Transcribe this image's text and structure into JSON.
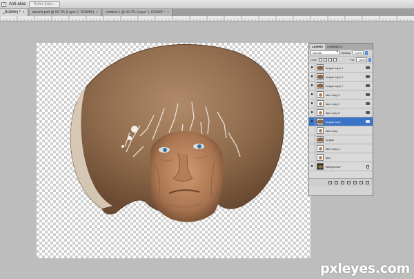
{
  "options_bar": {
    "antialias_label": "Anti-alias",
    "refine_edge_label": "Refine Edge..."
  },
  "tabs": [
    {
      "label": "_RGB/8#) *",
      "active": true
    },
    {
      "label": "ancient.psd @ 66.7% (Layer 2, RGB/8#)",
      "active": false
    },
    {
      "label": "Untitled-1 @ 66.7% (Layer 1, RGB/8) *",
      "active": false
    }
  ],
  "layers_panel": {
    "tab_layers": "LAYERS",
    "tab_channels": "CHANNELS",
    "blend_mode": "Normal",
    "opacity_label": "Opacity:",
    "opacity_value": "100%",
    "lock_label": "Lock:",
    "fill_label": "Fill:",
    "fill_value": "100%",
    "layers": [
      {
        "name": "fungus copy 4",
        "visible": true,
        "thumb": "fungus",
        "selected": false,
        "fx": true
      },
      {
        "name": "fungus copy 3",
        "visible": true,
        "thumb": "fungus",
        "selected": false,
        "fx": true
      },
      {
        "name": "fungus copy 2",
        "visible": true,
        "thumb": "fungus",
        "selected": false,
        "fx": true
      },
      {
        "name": "face copy 3",
        "visible": true,
        "thumb": "face",
        "selected": false,
        "fx": true
      },
      {
        "name": "face copy 4",
        "visible": true,
        "thumb": "face",
        "selected": false,
        "fx": true
      },
      {
        "name": "face copy 5",
        "visible": true,
        "thumb": "face",
        "selected": false,
        "fx": true
      },
      {
        "name": "fungus copy",
        "visible": true,
        "thumb": "fungus",
        "selected": true,
        "fx": true
      },
      {
        "name": "face copy",
        "visible": false,
        "thumb": "face",
        "selected": false,
        "fx": false
      },
      {
        "name": "fungus",
        "visible": false,
        "thumb": "fungus",
        "selected": false,
        "fx": false
      },
      {
        "name": "face copy 2",
        "visible": false,
        "thumb": "face",
        "selected": false,
        "fx": false
      },
      {
        "name": "face",
        "visible": false,
        "thumb": "face",
        "selected": false,
        "fx": false
      },
      {
        "name": "Background",
        "visible": true,
        "thumb": "bg",
        "selected": false,
        "fx": false,
        "locked": true,
        "italic": true
      }
    ]
  },
  "watermark": "pxleyes.com",
  "colors": {
    "selection": "#3b73c6",
    "fungus": "#8a6444",
    "skin": "#b08058"
  }
}
